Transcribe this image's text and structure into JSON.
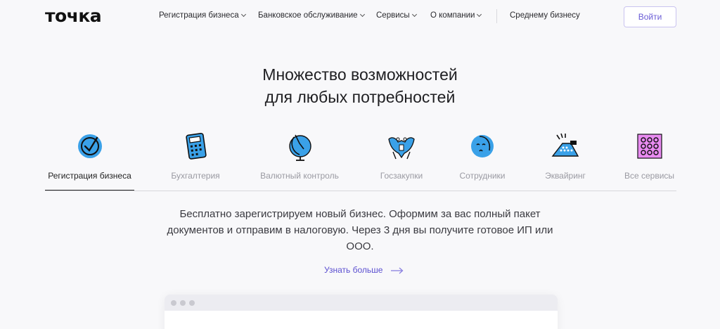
{
  "header": {
    "logo": "точка",
    "nav": [
      {
        "label": "Регистрация бизнеса",
        "dropdown": true
      },
      {
        "label": "Банковское обслуживание",
        "dropdown": true
      },
      {
        "label": "Сервисы",
        "dropdown": true
      },
      {
        "label": "О компании",
        "dropdown": true
      }
    ],
    "secondary_link": "Среднему бизнесу",
    "login_label": "Войти"
  },
  "hero": {
    "title_line1": "Множество возможностей",
    "title_line2": "для любых потребностей"
  },
  "tabs": [
    {
      "label": "Регистрация бизнеса",
      "icon": "check-circle-icon",
      "active": true
    },
    {
      "label": "Бухгалтерия",
      "icon": "calculator-icon",
      "active": false
    },
    {
      "label": "Валютный контроль",
      "icon": "globe-icon",
      "active": false
    },
    {
      "label": "Госзакупки",
      "icon": "eagle-emblem-icon",
      "active": false
    },
    {
      "label": "Сотрудники",
      "icon": "face-icon",
      "active": false
    },
    {
      "label": "Эквайринг",
      "icon": "payment-terminal-icon",
      "active": false
    },
    {
      "label": "Все сервисы",
      "icon": "grid-dots-icon",
      "active": false
    }
  ],
  "content": {
    "description": "Бесплатно зарегистрируем новый бизнес. Оформим за вас полный пакет документов и отправим в налоговую. Через 3 дня вы получите готовое ИП или ООО.",
    "more_label": "Узнать больше"
  },
  "colors": {
    "accent": "#5b4fd0",
    "icon_blue": "#3aa1e8",
    "icon_pink": "#e88bf0",
    "background": "#f8f8fa"
  }
}
